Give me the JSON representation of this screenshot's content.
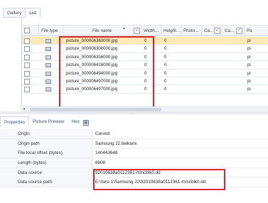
{
  "tabs": [
    {
      "label": "Gallery"
    },
    {
      "label": "List"
    }
  ],
  "grid": {
    "columns": [
      {
        "label": ""
      },
      {
        "label": "File type"
      },
      {
        "label": "File name"
      },
      {
        "label": "Width..."
      },
      {
        "label": "Height..."
      },
      {
        "label": "Photo..."
      },
      {
        "label": "Ca..."
      },
      {
        "label": "Ca..."
      },
      {
        "label": "Pa"
      }
    ],
    "filter_glyph": "✓",
    "sort_glyph": "▲",
    "rows": [
      {
        "file_name": "picture_000006380000.jpg",
        "width": "0",
        "height": "0",
        "path": "pi",
        "selected": true
      },
      {
        "file_name": "picture_000006306000.jpg",
        "width": "0",
        "height": "0",
        "path": "pi",
        "selected": false
      },
      {
        "file_name": "picture_000006356000.jpg",
        "width": "0",
        "height": "0",
        "path": "pi",
        "selected": false
      },
      {
        "file_name": "picture_000006416000.jpg",
        "width": "0",
        "height": "0",
        "path": "pi",
        "selected": false
      },
      {
        "file_name": "picture_000006494000.jpg",
        "width": "0",
        "height": "0",
        "path": "pi",
        "selected": false
      },
      {
        "file_name": "picture_000006497000.jpg",
        "width": "0",
        "height": "0",
        "path": "pi",
        "selected": false
      },
      {
        "file_name": "picture_000006497000.jpg",
        "width": "0",
        "height": "0",
        "path": "pi",
        "selected": false
      }
    ],
    "scroll_left_glyph": "◂",
    "splitter_glyph": "…"
  },
  "properties_tabs": [
    {
      "label": "Properties"
    },
    {
      "label": "Picture Preview"
    },
    {
      "label": "Hex"
    }
  ],
  "hex_icon_glyph": "▦",
  "properties": [
    {
      "key": "Origin",
      "value": "Carved"
    },
    {
      "key": "Origin path",
      "value": "Samsung J2.belkami"
    },
    {
      "key": "File local offset (bytes)",
      "value": "140443648"
    },
    {
      "key": "Length (bytes)",
      "value": "8808"
    },
    {
      "key": "Data source",
      "value": "92010638a0112361-mmcblk0.dd"
    },
    {
      "key": "Data source path",
      "value": "E:\\Sesi 1\\Samsung J2\\92010638a0112361-mmcblk0.dd"
    }
  ],
  "colors": {
    "highlight_red": "#e0242b",
    "selected_row": "#fde9b8",
    "tab_text": "#3a4f6b"
  },
  "icons": {
    "file_type": "image-file-icon",
    "filter": "filter-checkbox-icon",
    "hex_tab": "hex-grid-icon"
  }
}
